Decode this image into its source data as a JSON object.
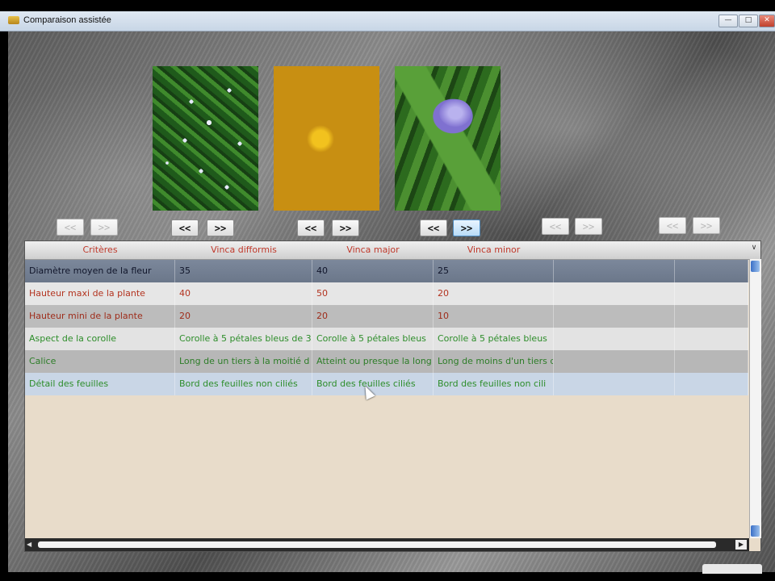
{
  "window": {
    "title": "Comparaison assistée",
    "controls": [
      "minimize-icon",
      "maximize-icon",
      "close-icon"
    ]
  },
  "nav": {
    "prev_label": "<<",
    "next_label": ">>"
  },
  "grid": {
    "headers": [
      "Critères",
      "Vinca difformis",
      "Vinca major",
      "Vinca minor",
      "",
      ""
    ],
    "rows": [
      [
        "Diamètre moyen de la fleur",
        "35",
        "40",
        "25",
        "",
        ""
      ],
      [
        "Hauteur maxi de la plante",
        "40",
        "50",
        "20",
        "",
        ""
      ],
      [
        "Hauteur mini de la plante",
        "20",
        "20",
        "10",
        "",
        ""
      ],
      [
        "Aspect de la corolle",
        "Corolle à 5 pétales bleus de 3",
        "Corolle à 5 pétales bleus",
        "Corolle à 5 pétales bleus",
        "",
        ""
      ],
      [
        "Calice",
        "Long de un tiers à la moitié d",
        "Atteint ou presque la long",
        "Long de moins d'un tiers d",
        "",
        ""
      ],
      [
        "Détail des feuilles",
        "Bord des feuilles non ciliés",
        "Bord des feuilles ciliés",
        "Bord des feuilles non cili",
        "",
        ""
      ]
    ]
  }
}
